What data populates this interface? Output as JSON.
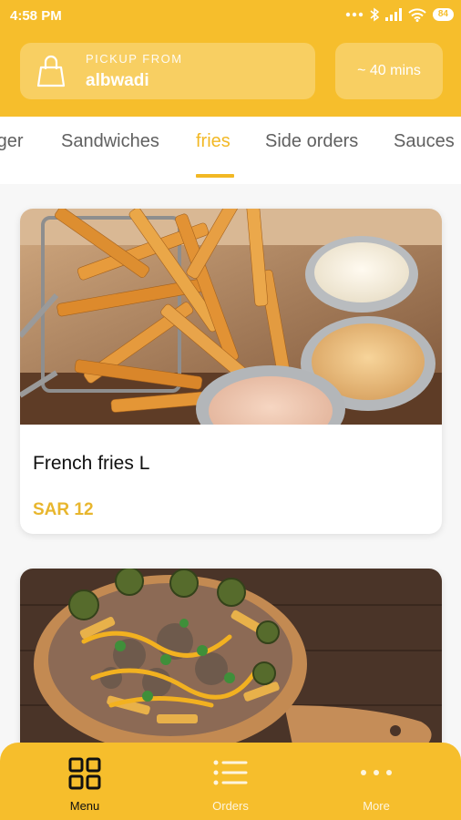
{
  "status": {
    "time": "4:58 PM",
    "battery": "84"
  },
  "pickup": {
    "label": "PICKUP FROM",
    "value": "albwadi",
    "icon": "shopping-bag-icon"
  },
  "eta": {
    "label": "~ 40 mins"
  },
  "categories": {
    "tabs": [
      "rger",
      "Sandwiches",
      "fries",
      "Side orders",
      "Sauces"
    ],
    "active": "fries"
  },
  "products": [
    {
      "name": "French fries L",
      "price": "SAR 12"
    },
    {
      "name": "",
      "price": ""
    }
  ],
  "nav": {
    "items": [
      {
        "label": "Menu",
        "icon": "grid-icon"
      },
      {
        "label": "Orders",
        "icon": "list-icon"
      },
      {
        "label": "More",
        "icon": "more-dots-icon"
      }
    ]
  },
  "colors": {
    "accent": "#f6be2c",
    "price": "#e8b62e"
  }
}
